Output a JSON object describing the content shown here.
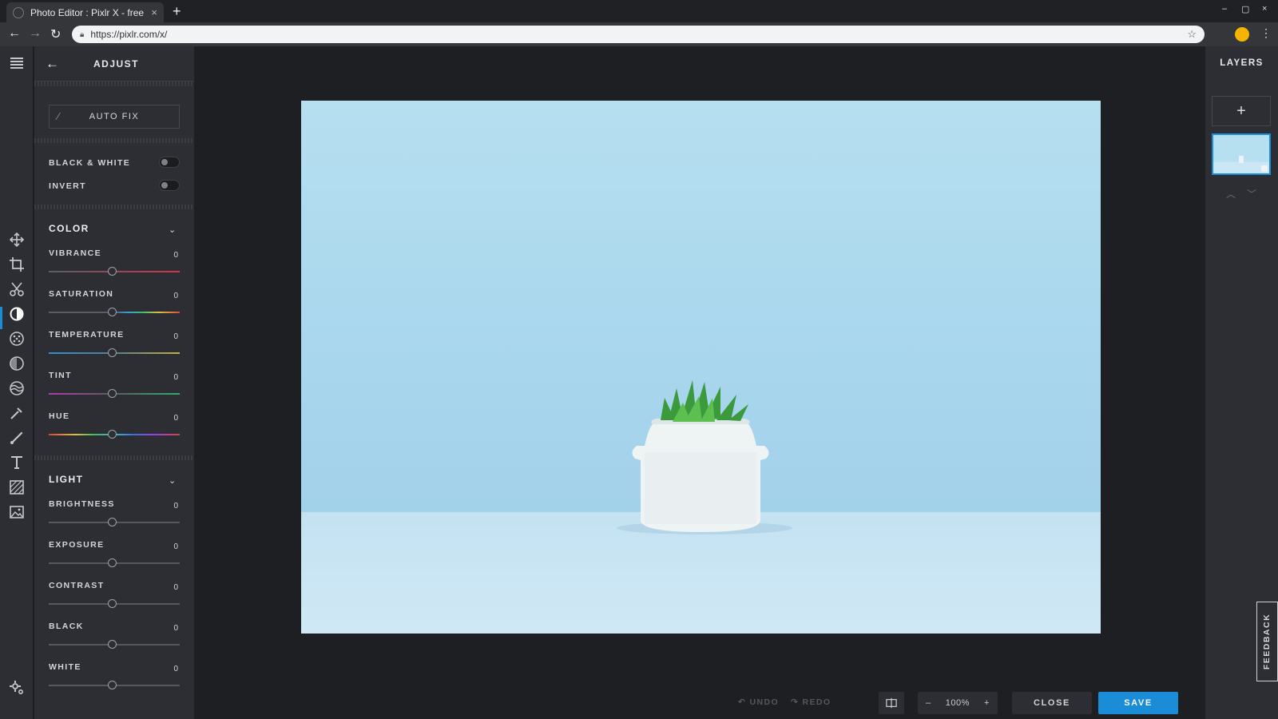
{
  "browser": {
    "tab_title": "Photo Editor : Pixlr X - free image editing online",
    "tab_close": "×",
    "new_tab": "+",
    "url": "https://pixlr.com/x/",
    "win_minimize": "–",
    "win_maximize": "▢",
    "win_close": "×"
  },
  "adjust_panel": {
    "title": "ADJUST",
    "auto_fix": "AUTO FIX",
    "black_white": "BLACK & WHITE",
    "invert": "INVERT",
    "color_section": {
      "title": "COLOR",
      "sliders": [
        {
          "label": "VIBRANCE",
          "value": "0"
        },
        {
          "label": "SATURATION",
          "value": "0"
        },
        {
          "label": "TEMPERATURE",
          "value": "0"
        },
        {
          "label": "TINT",
          "value": "0"
        },
        {
          "label": "HUE",
          "value": "0"
        }
      ]
    },
    "light_section": {
      "title": "LIGHT",
      "sliders": [
        {
          "label": "BRIGHTNESS",
          "value": "0"
        },
        {
          "label": "EXPOSURE",
          "value": "0"
        },
        {
          "label": "CONTRAST",
          "value": "0"
        },
        {
          "label": "BLACK",
          "value": "0"
        },
        {
          "label": "WHITE",
          "value": "0"
        }
      ]
    }
  },
  "tool_icons": [
    "menu-icon",
    "arrange-icon",
    "crop-icon",
    "cutout-icon",
    "adjust-icon",
    "filter-icon",
    "effect-icon",
    "liquify-icon",
    "retouch-icon",
    "draw-icon",
    "text-icon",
    "elements-icon",
    "add-image-icon",
    "settings-icon"
  ],
  "bottom_bar": {
    "undo": "UNDO",
    "redo": "REDO",
    "zoom_minus": "–",
    "zoom_level": "100%",
    "zoom_plus": "+",
    "close": "CLOSE",
    "save": "SAVE"
  },
  "layers_panel": {
    "title": "LAYERS",
    "add": "+"
  },
  "feedback": "FEEDBACK",
  "colors": {
    "accent": "#1a8cd8",
    "panel": "#2c2e33",
    "workspace": "#1e1f22"
  }
}
